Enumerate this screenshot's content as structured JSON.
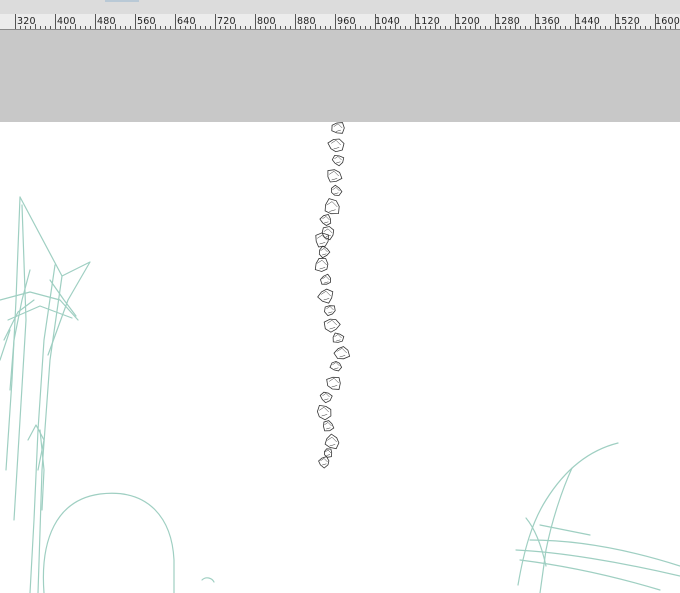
{
  "ruler": {
    "labels": [
      "320",
      "400",
      "480",
      "560",
      "640",
      "720",
      "800",
      "880",
      "960",
      "1040",
      "1120",
      "1200",
      "1280",
      "1360",
      "1440",
      "1520",
      "1600"
    ]
  },
  "colors": {
    "ruler_bg": "#ececec",
    "pasteboard": "#c8c8c8",
    "canvas": "#ffffff",
    "sketch_stroke": "#9fcfc2",
    "chain_stroke": "#333333"
  },
  "icons": [
    "ruler-ticks",
    "sketch-strokes",
    "bead-chain-drawing"
  ]
}
